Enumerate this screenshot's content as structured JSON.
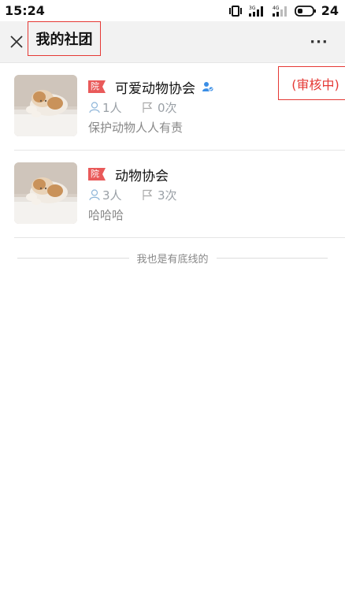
{
  "status_bar": {
    "time": "15:24",
    "sim1_label": "3G",
    "sim2_label": "4G",
    "battery": "24"
  },
  "header": {
    "title": "我的社团",
    "close_icon": "close-icon",
    "more_icon": "more-icon",
    "more_label": "···"
  },
  "clubs": [
    {
      "badge": "院",
      "name": "可爱动物协会",
      "verified": true,
      "members": "1人",
      "activities": "0次",
      "description": "保护动物人人有责",
      "status": "(审核中)"
    },
    {
      "badge": "院",
      "name": "动物协会",
      "verified": false,
      "members": "3人",
      "activities": "3次",
      "description": "哈哈哈",
      "status": ""
    }
  ],
  "footer": {
    "text": "我也是有底线的"
  },
  "colors": {
    "accent_red": "#e53935",
    "badge_red": "#e95a5a",
    "header_bg": "#f2f2f2",
    "verified_blue": "#3a8ee6"
  }
}
